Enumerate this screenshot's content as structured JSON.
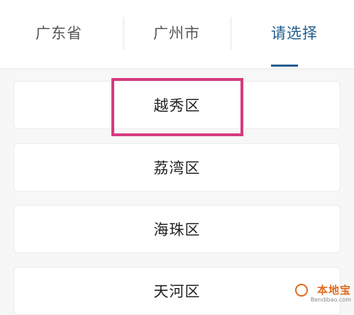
{
  "tabs": [
    {
      "label": "广东省",
      "active": false
    },
    {
      "label": "广州市",
      "active": false
    },
    {
      "label": "请选择",
      "active": true
    }
  ],
  "districts": [
    {
      "label": "越秀区",
      "highlighted": true
    },
    {
      "label": "荔湾区",
      "highlighted": false
    },
    {
      "label": "海珠区",
      "highlighted": false
    },
    {
      "label": "天河区",
      "highlighted": false
    }
  ],
  "watermark": {
    "text": "本地宝",
    "subtext": "Bendibao.com"
  },
  "colors": {
    "accent": "#1f5c8e",
    "highlight_border": "#d63a7e",
    "background": "#f7f7f7",
    "card": "#ffffff"
  }
}
